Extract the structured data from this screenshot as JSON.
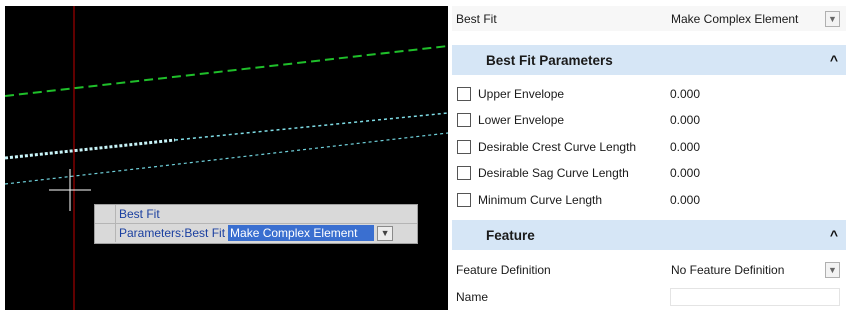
{
  "prompt": {
    "title": "Best Fit",
    "param_label": "Parameters:Best Fit",
    "param_value": "Make Complex Element"
  },
  "panel": {
    "top_row": {
      "label": "Best Fit",
      "value": "Make Complex Element"
    },
    "section_params": {
      "title": "Best Fit Parameters",
      "items": [
        {
          "label": "Upper Envelope",
          "value": "0.000",
          "checked": false
        },
        {
          "label": "Lower Envelope",
          "value": "0.000",
          "checked": false
        },
        {
          "label": "Desirable Crest Curve Length",
          "value": "0.000",
          "checked": false
        },
        {
          "label": "Desirable Sag Curve Length",
          "value": "0.000",
          "checked": false
        },
        {
          "label": "Minimum Curve Length",
          "value": "0.000",
          "checked": false
        }
      ]
    },
    "section_feature": {
      "title": "Feature",
      "definition_label": "Feature Definition",
      "definition_value": "No Feature Definition",
      "name_label": "Name",
      "name_value": ""
    }
  },
  "colors": {
    "section_header_bg": "#d6e6f6",
    "selection_bg": "#3a6fd0",
    "green_line": "#1fbf2a",
    "cyan_line": "#9be8f0",
    "red_line": "#c00000"
  },
  "icons": {
    "caret_up": "caret-up-icon",
    "dropdown": "chevron-down-icon",
    "cursor": "crosshair-cursor-icon"
  }
}
